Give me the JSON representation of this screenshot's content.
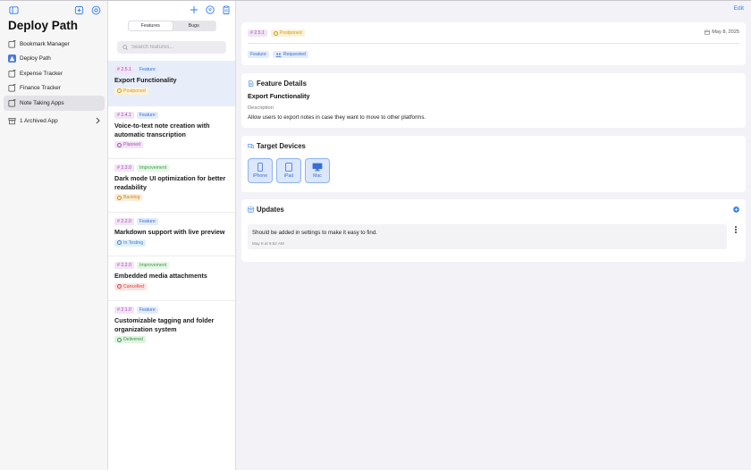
{
  "sidebar": {
    "title": "Deploy Path",
    "apps": [
      {
        "label": "Bookmark Manager",
        "icon": "app-placeholder-icon",
        "selected": false
      },
      {
        "label": "Deploy Path",
        "icon": "app-image-icon",
        "selected": false
      },
      {
        "label": "Expense Tracker",
        "icon": "app-placeholder-icon",
        "selected": false
      },
      {
        "label": "Finance Tracker",
        "icon": "app-placeholder-icon",
        "selected": false
      },
      {
        "label": "Note Taking Apps",
        "icon": "app-placeholder-icon",
        "selected": true
      }
    ],
    "archived_label": "1 Archived App"
  },
  "list": {
    "segments": [
      "Features",
      "Bugs"
    ],
    "active_segment": "Features",
    "search_placeholder": "Search features...",
    "features": [
      {
        "version": "# 2.5.1 ",
        "type": "Feature",
        "title": "Export Functionality",
        "status": "Postponed",
        "status_key": "postponed",
        "selected": true
      },
      {
        "version": "# 2.4.1 ",
        "type": "Feature",
        "title": "Voice-to-text note creation with automatic transcription",
        "status": "Planned",
        "status_key": "planned",
        "selected": false
      },
      {
        "version": "# 2.3.0 ",
        "type": "Improvement",
        "title": "Dark mode UI optimization for better readability",
        "status": "Backlog",
        "status_key": "backlog",
        "selected": false
      },
      {
        "version": "# 2.2.0 ",
        "type": "Feature",
        "title": "Markdown support with live preview",
        "status": "In Testing",
        "status_key": "testing",
        "selected": false
      },
      {
        "version": "# 2.2.0 ",
        "type": "Improvement",
        "title": "Embedded media attachments",
        "status": "Cancelled",
        "status_key": "cancelled",
        "selected": false
      },
      {
        "version": "# 2.1.0 ",
        "type": "Feature",
        "title": "Customizable tagging and folder organization system",
        "status": "Delivered",
        "status_key": "delivered",
        "selected": false
      }
    ]
  },
  "detail": {
    "edit_label": "Edit",
    "version": "# 2.5.1 ",
    "status": "Postponed",
    "date": "May 8, 2025",
    "type": "Feature",
    "requested": "Requested",
    "feature_details_heading": "Feature Details",
    "feature_title": "Export Functionality",
    "description_label": "Description",
    "description": "Allow users to export notes in case they want to move to other platforms.",
    "target_devices_heading": "Target Devices",
    "devices": [
      "iPhone",
      "iPad",
      "Mac"
    ],
    "updates_heading": "Updates",
    "updates": [
      {
        "text": "Should be added in settings to make it easy to find.",
        "time": "May 8 at 9:52 AM"
      }
    ]
  },
  "colors": {
    "accent": "#2f7cf6",
    "selected_row": "#e8eef9",
    "sidebar_selected": "#e2e2e7"
  }
}
